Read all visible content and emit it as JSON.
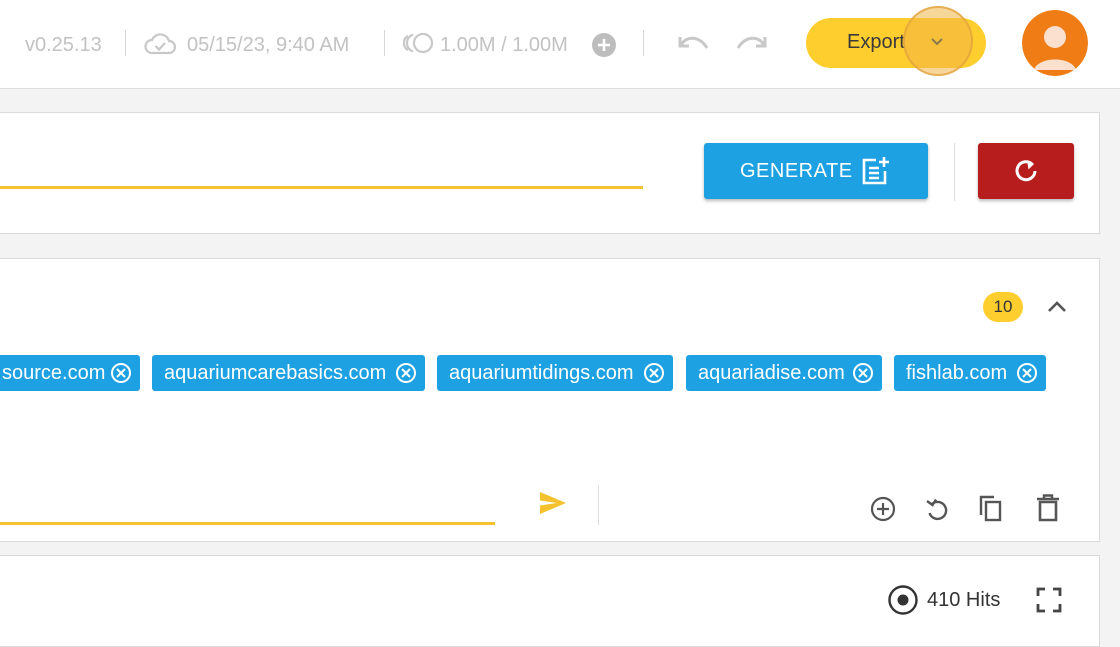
{
  "header": {
    "version": "v0.25.13",
    "sync_time": "05/15/23, 9:40 AM",
    "credits": "1.00M / 1.00M",
    "export_label": "Export",
    "icons": [
      "cloud-done-icon",
      "credits-icon",
      "add-circle-icon",
      "undo-icon",
      "redo-icon",
      "chevron-down-icon",
      "user-avatar-icon"
    ]
  },
  "generate_panel": {
    "generate_label": "GENERATE",
    "icons": [
      "post-add-icon",
      "refresh-icon"
    ]
  },
  "domains_panel": {
    "count": "10",
    "chips": [
      {
        "label": "source.com"
      },
      {
        "label": "aquariumcarebasics.com"
      },
      {
        "label": "aquariumtidings.com"
      },
      {
        "label": "aquariadise.com"
      },
      {
        "label": "fishlab.com"
      }
    ],
    "icons": [
      "chevron-up-icon",
      "send-icon",
      "add-circle-outline-icon",
      "restore-icon",
      "copy-icon",
      "delete-icon"
    ]
  },
  "results_panel": {
    "hits_label": "410 Hits",
    "icons": [
      "target-icon",
      "fullscreen-icon"
    ]
  },
  "colors": {
    "accent_yellow": "#fecd2e",
    "primary_blue": "#1da1e2",
    "danger_red": "#b61d1c",
    "avatar_orange": "#f07c15"
  }
}
